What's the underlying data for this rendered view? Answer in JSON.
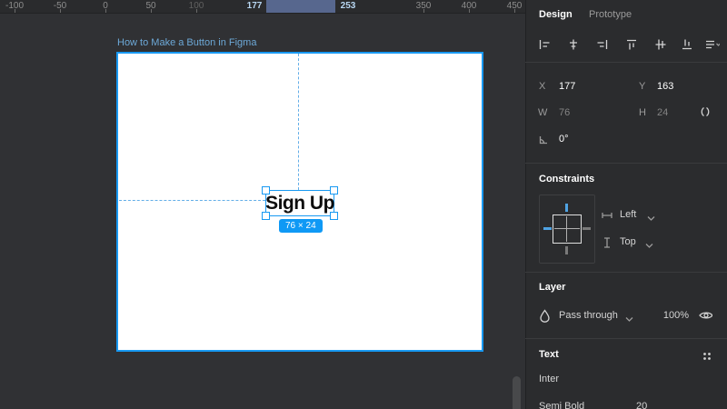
{
  "ruler": {
    "labels": [
      {
        "text": "-100"
      },
      {
        "text": "-50"
      },
      {
        "text": "0"
      },
      {
        "text": "50"
      },
      {
        "text": "100"
      },
      {
        "text": "177"
      },
      {
        "text": "253"
      },
      {
        "text": "350"
      },
      {
        "text": "400"
      },
      {
        "text": "450"
      }
    ],
    "selection_start": "177",
    "selection_end": "253"
  },
  "canvas": {
    "frame_title": "How to Make a Button in Figma",
    "button_label": "Sign Up",
    "size_badge": "76 × 24"
  },
  "panel": {
    "tabs": {
      "design": "Design",
      "prototype": "Prototype"
    },
    "align_icons": [
      "align-left",
      "align-horizontal-centers",
      "align-right",
      "align-top",
      "align-vertical-centers",
      "align-bottom",
      "distribute-options"
    ],
    "position": {
      "x_label": "X",
      "x_value": "177",
      "y_label": "Y",
      "y_value": "163",
      "w_label": "W",
      "w_value": "76",
      "h_label": "H",
      "h_value": "24",
      "rotation_value": "0°"
    },
    "constraints": {
      "title": "Constraints",
      "horizontal_value": "Left",
      "vertical_value": "Top"
    },
    "layer": {
      "title": "Layer",
      "blend_mode": "Pass through",
      "opacity": "100%"
    },
    "text": {
      "title": "Text",
      "font_family": "Inter",
      "font_style": "Semi Bold",
      "font_size": "20"
    }
  },
  "colors": {
    "accent": "#0f99f5",
    "guide": "#63aee8",
    "ruler_highlight": "#57678e",
    "frame_title": "#6da9d8",
    "canvas_bg": "#303134",
    "panel_bg": "#2b2c2e"
  }
}
